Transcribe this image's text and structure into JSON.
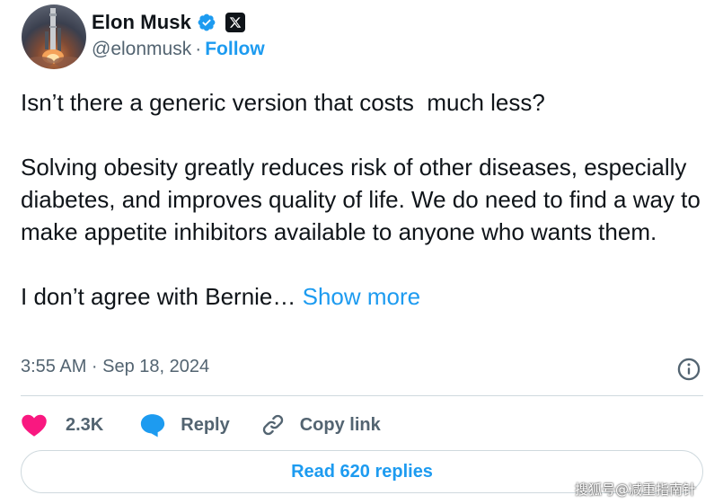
{
  "author": {
    "name": "Elon Musk",
    "handle": "@elonmusk",
    "separator": "·",
    "follow_label": "Follow",
    "verified_icon": "verified-badge-icon",
    "affiliate_icon": "x-logo-icon"
  },
  "tweet": {
    "paragraph_1": "Isn’t there a generic version that costs  much less?",
    "paragraph_2": "Solving obesity greatly reduces risk of other diseases, especially diabetes, and improves quality of life. We do need to find a way to make appetite inhibitors available to anyone who wants them.",
    "paragraph_3": "I don’t agree with Bernie… ",
    "show_more_label": "Show more",
    "timestamp": "3:55 AM · Sep 18, 2024"
  },
  "actions": {
    "like_count": "2.3K",
    "reply_label": "Reply",
    "copy_link_label": "Copy link"
  },
  "read_replies_label": "Read 620 replies",
  "watermark": "搜狐号@减重指南针",
  "colors": {
    "accent": "#1d9bf0",
    "like": "#f91880",
    "text": "#0f1419",
    "secondary": "#536471",
    "border": "#cfd9de"
  }
}
